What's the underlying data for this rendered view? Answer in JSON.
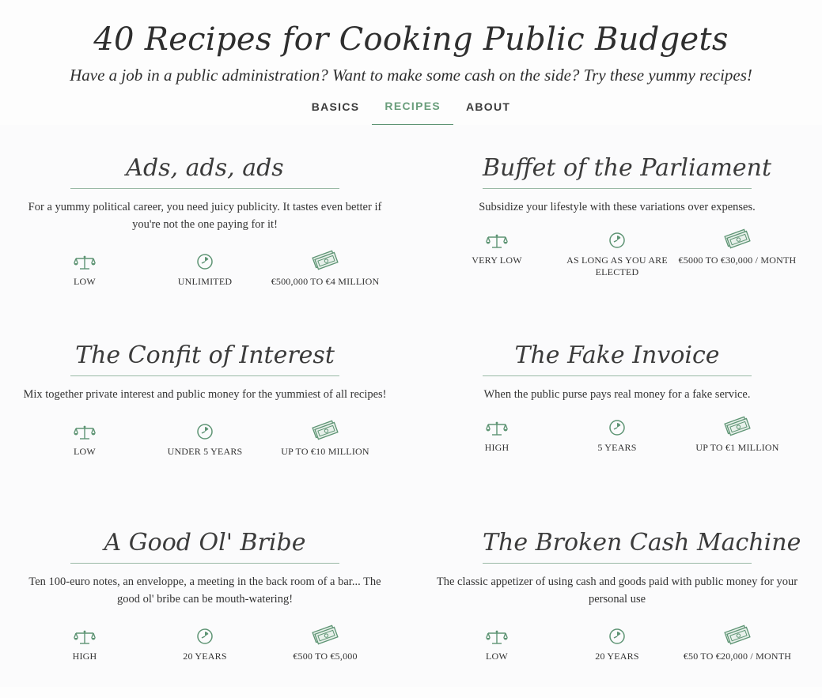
{
  "header": {
    "title": "40 Recipes for Cooking Public Budgets",
    "subtitle": "Have a job in a public administration? Want to make some cash on the side? Try these yummy recipes!"
  },
  "nav": {
    "tabs": [
      {
        "label": "BASICS",
        "active": false
      },
      {
        "label": "RECIPES",
        "active": true
      },
      {
        "label": "ABOUT",
        "active": false
      }
    ]
  },
  "icons": {
    "risk": "scales-icon",
    "duration": "clock-icon",
    "amount": "banknotes-icon"
  },
  "colors": {
    "accent": "#5e9474"
  },
  "recipes": [
    {
      "title": "Ads, ads, ads",
      "description": "For a yummy political career, you need juicy publicity. It tastes even better if you're not the one paying for it!",
      "risk": "LOW",
      "duration": "UNLIMITED",
      "amount": "€500,000 TO €4 MILLION"
    },
    {
      "title": "Buffet of the Parliament",
      "description": "Subsidize your lifestyle with these variations over expenses.",
      "risk": "VERY LOW",
      "duration": "AS LONG AS YOU ARE ELECTED",
      "amount": "€5000 TO €30,000 / MONTH"
    },
    {
      "title": "The Confit of Interest",
      "description": "Mix together private interest and public money for the yummiest of all recipes!",
      "risk": "LOW",
      "duration": "UNDER 5 YEARS",
      "amount": "UP TO €10 MILLION"
    },
    {
      "title": "The Fake Invoice",
      "description": "When the public purse pays real money for a fake service.",
      "risk": "HIGH",
      "duration": "5 YEARS",
      "amount": "UP TO €1 MILLION"
    },
    {
      "title": "A Good Ol' Bribe",
      "description": "Ten 100-euro notes, an enveloppe, a meeting in the back room of a bar... The good ol' bribe can be mouth-watering!",
      "risk": "HIGH",
      "duration": "20 YEARS",
      "amount": "€500 TO €5,000"
    },
    {
      "title": "The Broken Cash Machine",
      "description": "The classic appetizer of using cash and goods paid with public money for your personal use",
      "risk": "LOW",
      "duration": "20 YEARS",
      "amount": "€50 TO €20,000 / MONTH"
    }
  ]
}
